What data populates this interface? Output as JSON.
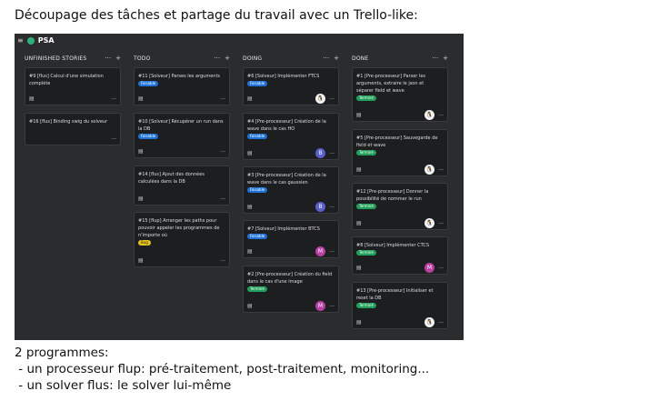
{
  "heading": "Découpage des tâches et partage du travail avec un Trello-like:",
  "board": {
    "menu_icon": "≡",
    "name": "PSA",
    "dot_color": "#2ab27b"
  },
  "icons": {
    "more": "···",
    "add": "+",
    "doc": "▤",
    "tux": "🐧"
  },
  "columns": [
    {
      "title": "UNFINISHED STORIES",
      "cards": [
        {
          "text": "#9 [flus] Calcul d'une simulation complète"
        },
        {
          "text": "#16 [flus] Binding swig du solveur"
        }
      ]
    },
    {
      "title": "TODO",
      "cards": [
        {
          "text": "#11 [Solveur] Parses les arguments",
          "tag": "Faisable"
        },
        {
          "text": "#10 [Solveur] Récupérer un run dans la DB",
          "tag": "Faisable"
        },
        {
          "text": "#14 [flus] Ajout des données calculées dans la DB"
        },
        {
          "text": "#15 [flup] Arranger les paths pour pouvoir appeler les programmes de n'importe où",
          "tag": "Bug"
        }
      ]
    },
    {
      "title": "DOING",
      "cards": [
        {
          "text": "#6 [Solveur] Implémenter FTCS",
          "tag": "Faisable",
          "avatar": "🐧"
        },
        {
          "text": "#4 [Pre-processeur] Création de la wave dans le cas HO",
          "tag": "Faisable",
          "avatar": "B"
        },
        {
          "text": "#3 [Pre-processeur] Création de la wave dans le cas gaussien",
          "tag": "Faisable",
          "avatar": "B"
        },
        {
          "text": "#7 [Solveur] Implémenter BTCS",
          "tag": "Faisable",
          "avatar": "M"
        },
        {
          "text": "#2 [Pre-processeur] Création du field dans le cas d'une image",
          "tag": "Terminé",
          "avatar": "M"
        }
      ]
    },
    {
      "title": "DONE",
      "cards": [
        {
          "text": "#1 [Pre-processeur] Parser les arguments, extraire le json et séparer field et wave",
          "tag": "Terminé",
          "avatar": "🐧"
        },
        {
          "text": "#5 [Pre-processeur] Sauvegarde de field et wave",
          "tag": "Terminé",
          "avatar": "🐧"
        },
        {
          "text": "#12 [Pre-processeur] Donner la possibilité de nommer le run",
          "tag": "Terminé",
          "avatar": "🐧"
        },
        {
          "text": "#8 [Solveur] Implémenter CTCS",
          "tag": "Terminé",
          "avatar": "M"
        },
        {
          "text": "#13 [Pre-processeur] Initialiser et reset la DB",
          "tag": "Terminé",
          "avatar": "🐧"
        }
      ]
    }
  ],
  "tag_colors": {
    "Faisable": "#1f73d8",
    "Terminé": "#21a05b",
    "Bug": "#e7c51b"
  },
  "footer": {
    "line1": "2 programmes:",
    "line2": " - un processeur flup: pré-traitement, post-traitement, monitoring...",
    "line3": " - un solver flus: le solver lui-même"
  }
}
